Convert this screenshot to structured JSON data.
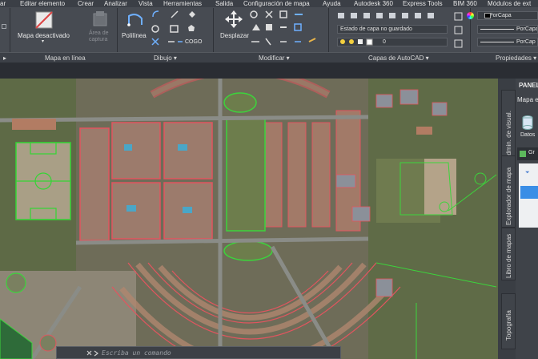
{
  "menu": [
    "ar",
    "Editar elemento",
    "Crear",
    "Analizar",
    "Vista",
    "Herramientas",
    "Salida",
    "Configuración de mapa",
    "Ayuda",
    "Autodesk 360",
    "Express Tools",
    "BIM 360",
    "Módulos de ext"
  ],
  "ribbon": {
    "map_off_label": "Mapa desactivado",
    "capture_area_label": "Área de captura",
    "polyline_label": "Polilínea",
    "cogo_label": "COGO",
    "move_label": "Desplazar",
    "layer_state_value": "Estado de capa no guardado",
    "layer_value": "0",
    "porcapa_color": "PorCapa",
    "porcapa_line1": "PorCapa",
    "porcapa_line2": "PorCap"
  },
  "panels": {
    "online_map": "Mapa en línea",
    "draw": "Dibujo ▾",
    "modify": "Modificar ▾",
    "layers": "Capas de AutoCAD ▾",
    "properties": "Propiedades ▾"
  },
  "side_palette": {
    "title": "PANEL",
    "subtitle": "Mapa e",
    "data_label": "Datos",
    "group_label": "Gr",
    "tabs": [
      "Admin. de visual.",
      "Explorador de mapa",
      "Libro de mapas",
      "Topografía"
    ]
  },
  "command_line": {
    "placeholder": "Escriba un comando"
  },
  "colors": {
    "ribbon_bg": "#474b52",
    "accent": "#3a8ee6",
    "boundary": "#e2555f",
    "green_lines": "#4bd24b"
  }
}
